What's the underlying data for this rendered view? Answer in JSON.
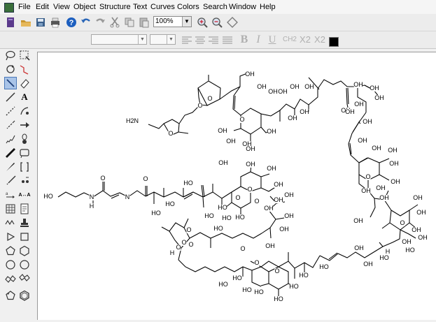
{
  "menubar": {
    "items": [
      "File",
      "Edit",
      "View",
      "Object",
      "Structure",
      "Text",
      "Curves",
      "Colors",
      "Search",
      "Window",
      "Help"
    ]
  },
  "toolbar": {
    "zoom_value": "100%"
  },
  "format_toolbar": {
    "bold": "B",
    "italic": "I",
    "underline": "U",
    "chemical_formula": "CH2",
    "subscript": "X2",
    "superscript": "X2",
    "color_swatch": "#000000"
  },
  "palette": {
    "text_tool_label": "A",
    "atom_map_label": "A↔A"
  },
  "structure": {
    "atom_labels": [
      "OH",
      "OH",
      "OH",
      "OH",
      "OH",
      "OH",
      "OH",
      "OH",
      "OH",
      "OH",
      "OH",
      "OH",
      "OH",
      "OH",
      "OH",
      "OH",
      "OH",
      "OH",
      "OH",
      "OH",
      "OH",
      "OH",
      "OH",
      "OH",
      "OH",
      "OH",
      "OH",
      "OH",
      "OH",
      "OH",
      "OH",
      "OH",
      "OH",
      "OH",
      "OH",
      "OH",
      "OH",
      "OH",
      "OH",
      "OH",
      "OH",
      "OH",
      "OH",
      "OH",
      "OH",
      "OH",
      "O",
      "O",
      "O",
      "O",
      "O",
      "O",
      "O",
      "O",
      "O",
      "O",
      "O",
      "O",
      "O",
      "O",
      "O",
      "O",
      "H2N",
      "HO",
      "N",
      "H",
      "N",
      "H",
      "O",
      "O",
      "HO",
      "HO",
      "HO",
      "HO",
      "HO",
      "HO",
      "HO",
      "HO",
      "HO",
      "HO",
      "HO",
      "HO",
      "HO",
      "HO",
      "HO",
      "HO",
      "HO",
      "HO",
      "H"
    ]
  }
}
